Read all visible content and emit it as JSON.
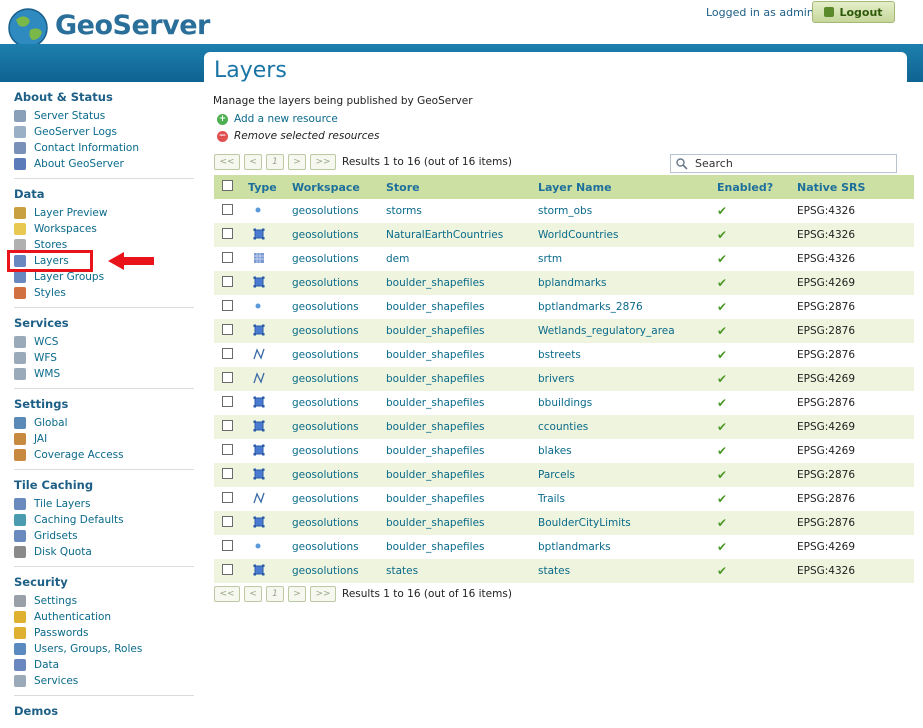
{
  "header": {
    "app_name": "GeoServer",
    "logged_in_text": "Logged in as admin.",
    "logout_label": "Logout"
  },
  "sidebar": {
    "sections": [
      {
        "title": "About & Status",
        "items": [
          {
            "label": "Server Status",
            "icon": "server-status-icon",
            "color": "#8aa0b8"
          },
          {
            "label": "GeoServer Logs",
            "icon": "logs-icon",
            "color": "#9ab0c4"
          },
          {
            "label": "Contact Information",
            "icon": "contact-icon",
            "color": "#7a90b8"
          },
          {
            "label": "About GeoServer",
            "icon": "about-icon",
            "color": "#5a7ab8"
          }
        ]
      },
      {
        "title": "Data",
        "items": [
          {
            "label": "Layer Preview",
            "icon": "layer-preview-icon",
            "color": "#c8a040"
          },
          {
            "label": "Workspaces",
            "icon": "workspaces-icon",
            "color": "#e8c850"
          },
          {
            "label": "Stores",
            "icon": "stores-icon",
            "color": "#b0b0b0"
          },
          {
            "label": "Layers",
            "icon": "layers-icon",
            "color": "#6a88c0"
          },
          {
            "label": "Layer Groups",
            "icon": "layer-groups-icon",
            "color": "#6a88c0"
          },
          {
            "label": "Styles",
            "icon": "styles-icon",
            "color": "#d07040"
          }
        ]
      },
      {
        "title": "Services",
        "items": [
          {
            "label": "WCS",
            "icon": "wcs-icon",
            "color": "#9aaab8"
          },
          {
            "label": "WFS",
            "icon": "wfs-icon",
            "color": "#9aaab8"
          },
          {
            "label": "WMS",
            "icon": "wms-icon",
            "color": "#9aaab8"
          }
        ]
      },
      {
        "title": "Settings",
        "items": [
          {
            "label": "Global",
            "icon": "global-icon",
            "color": "#5a8ab8"
          },
          {
            "label": "JAI",
            "icon": "jai-icon",
            "color": "#c88a40"
          },
          {
            "label": "Coverage Access",
            "icon": "coverage-access-icon",
            "color": "#c88a40"
          }
        ]
      },
      {
        "title": "Tile Caching",
        "items": [
          {
            "label": "Tile Layers",
            "icon": "tile-layers-icon",
            "color": "#6a8ac0"
          },
          {
            "label": "Caching Defaults",
            "icon": "caching-defaults-icon",
            "color": "#4a9ab0"
          },
          {
            "label": "Gridsets",
            "icon": "gridsets-icon",
            "color": "#6a8ac0"
          },
          {
            "label": "Disk Quota",
            "icon": "disk-quota-icon",
            "color": "#8a8a8a"
          }
        ]
      },
      {
        "title": "Security",
        "items": [
          {
            "label": "Settings",
            "icon": "security-settings-icon",
            "color": "#9aa0a8"
          },
          {
            "label": "Authentication",
            "icon": "authentication-icon",
            "color": "#e0b030"
          },
          {
            "label": "Passwords",
            "icon": "passwords-icon",
            "color": "#e0b030"
          },
          {
            "label": "Users, Groups, Roles",
            "icon": "users-icon",
            "color": "#5a8ac0"
          },
          {
            "label": "Data",
            "icon": "security-data-icon",
            "color": "#6a88c0"
          },
          {
            "label": "Services",
            "icon": "security-services-icon",
            "color": "#9aaab8"
          }
        ]
      },
      {
        "title": "Demos",
        "items": []
      }
    ]
  },
  "main": {
    "title": "Layers",
    "description": "Manage the layers being published by GeoServer",
    "add_label": "Add a new resource",
    "remove_label": "Remove selected resources",
    "pager": {
      "first": "<<",
      "prev": "<",
      "page": "1",
      "next": ">",
      "last": ">>",
      "results": "Results 1 to 16 (out of 16 items)"
    },
    "search_placeholder": "Search",
    "columns": [
      "Type",
      "Workspace",
      "Store",
      "Layer Name",
      "Enabled?",
      "Native SRS"
    ],
    "rows": [
      {
        "type": "point",
        "workspace": "geosolutions",
        "store": "storms",
        "layer": "storm_obs",
        "enabled": "✔",
        "srs": "EPSG:4326"
      },
      {
        "type": "polygon",
        "workspace": "geosolutions",
        "store": "NaturalEarthCountries",
        "layer": "WorldCountries",
        "enabled": "✔",
        "srs": "EPSG:4326"
      },
      {
        "type": "raster",
        "workspace": "geosolutions",
        "store": "dem",
        "layer": "srtm",
        "enabled": "✔",
        "srs": "EPSG:4326"
      },
      {
        "type": "polygon",
        "workspace": "geosolutions",
        "store": "boulder_shapefiles",
        "layer": "bplandmarks",
        "enabled": "✔",
        "srs": "EPSG:4269"
      },
      {
        "type": "point",
        "workspace": "geosolutions",
        "store": "boulder_shapefiles",
        "layer": "bptlandmarks_2876",
        "enabled": "✔",
        "srs": "EPSG:2876"
      },
      {
        "type": "polygon",
        "workspace": "geosolutions",
        "store": "boulder_shapefiles",
        "layer": "Wetlands_regulatory_area",
        "enabled": "✔",
        "srs": "EPSG:2876"
      },
      {
        "type": "line",
        "workspace": "geosolutions",
        "store": "boulder_shapefiles",
        "layer": "bstreets",
        "enabled": "✔",
        "srs": "EPSG:2876"
      },
      {
        "type": "line",
        "workspace": "geosolutions",
        "store": "boulder_shapefiles",
        "layer": "brivers",
        "enabled": "✔",
        "srs": "EPSG:4269"
      },
      {
        "type": "polygon",
        "workspace": "geosolutions",
        "store": "boulder_shapefiles",
        "layer": "bbuildings",
        "enabled": "✔",
        "srs": "EPSG:2876"
      },
      {
        "type": "polygon",
        "workspace": "geosolutions",
        "store": "boulder_shapefiles",
        "layer": "ccounties",
        "enabled": "✔",
        "srs": "EPSG:4269"
      },
      {
        "type": "polygon",
        "workspace": "geosolutions",
        "store": "boulder_shapefiles",
        "layer": "blakes",
        "enabled": "✔",
        "srs": "EPSG:4269"
      },
      {
        "type": "polygon",
        "workspace": "geosolutions",
        "store": "boulder_shapefiles",
        "layer": "Parcels",
        "enabled": "✔",
        "srs": "EPSG:2876"
      },
      {
        "type": "line",
        "workspace": "geosolutions",
        "store": "boulder_shapefiles",
        "layer": "Trails",
        "enabled": "✔",
        "srs": "EPSG:2876"
      },
      {
        "type": "polygon",
        "workspace": "geosolutions",
        "store": "boulder_shapefiles",
        "layer": "BoulderCityLimits",
        "enabled": "✔",
        "srs": "EPSG:2876"
      },
      {
        "type": "point",
        "workspace": "geosolutions",
        "store": "boulder_shapefiles",
        "layer": "bptlandmarks",
        "enabled": "✔",
        "srs": "EPSG:4269"
      },
      {
        "type": "polygon",
        "workspace": "geosolutions",
        "store": "states",
        "layer": "states",
        "enabled": "✔",
        "srs": "EPSG:4326"
      }
    ]
  },
  "colors": {
    "accent": "#1d7fae",
    "header_row": "#cde0a3",
    "highlight": "#e8141a",
    "check": "#4c9a2a"
  }
}
